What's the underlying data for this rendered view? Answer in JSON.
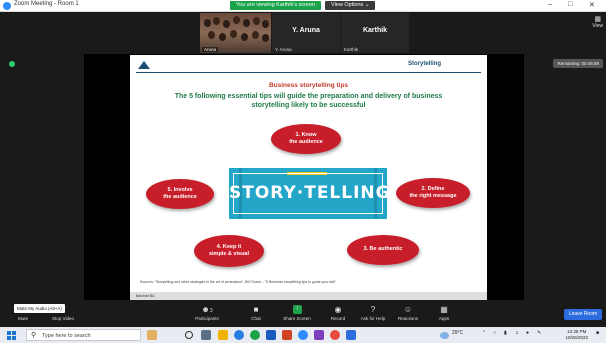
{
  "window": {
    "title": "Zoom Meeting - Room 1",
    "viewing_banner": "You are viewing Karthik's screen",
    "view_options": "View Options ⌄",
    "minimize": "–",
    "maximize": "□",
    "close": "✕"
  },
  "participants": [
    {
      "name": "Aruna",
      "tag": "Y. Aruna",
      "type": "video"
    },
    {
      "big": "Y. Aruna",
      "small": "Y. Aruna",
      "type": "name"
    },
    {
      "big": "Karthik",
      "small": "Karthik",
      "type": "name"
    }
  ],
  "view_button": "View",
  "remaining": "Remaining: 00:45:59",
  "slide": {
    "header": "Storytelling",
    "title": "Business storytelling tips",
    "subtitle": "The 5 following essential tips will guide the preparation and delivery of business storytelling likely to be successful",
    "banner_word": "STORY·TELLING",
    "tips": [
      {
        "line1": "1. Know",
        "line2": "the audience"
      },
      {
        "line1": "2. Define",
        "line2": "the right message"
      },
      {
        "line1": "3. Be authentic",
        "line2": ""
      },
      {
        "line1": "4. Keep it",
        "line2": "simple & visual"
      },
      {
        "line1": "5. Involve",
        "line2": "the audience"
      }
    ],
    "source": "Sources: \"Storytelling and other strategies in the art of persuasion\", Bill Chase – \"5 Business storytelling tips to guide your talk\"",
    "footer_label": "Barchait BA"
  },
  "tooltip": "Mute My Audio (Alt+A)",
  "toolbar": {
    "mute": "Mute",
    "stop_video": "Stop Video",
    "participants": "Participants",
    "participants_count": "3",
    "chat": "Chat",
    "share_screen": "Share Screen",
    "record": "Record",
    "ask_for_help": "Ask for Help",
    "reactions": "Reactions",
    "apps": "Apps",
    "leave_room": "Leave Room"
  },
  "taskbar": {
    "search_placeholder": "Type here to search",
    "weather": "29°C",
    "clock_time": "12:38 PM",
    "clock_date": "10/26/2022"
  },
  "colors": {
    "slide_accent": "#c81e2a",
    "subtitle_green": "#1e7a4a",
    "banner_blue": "#24a6c9",
    "share_green": "#1ea34b",
    "leave_blue": "#2d6cdf"
  }
}
